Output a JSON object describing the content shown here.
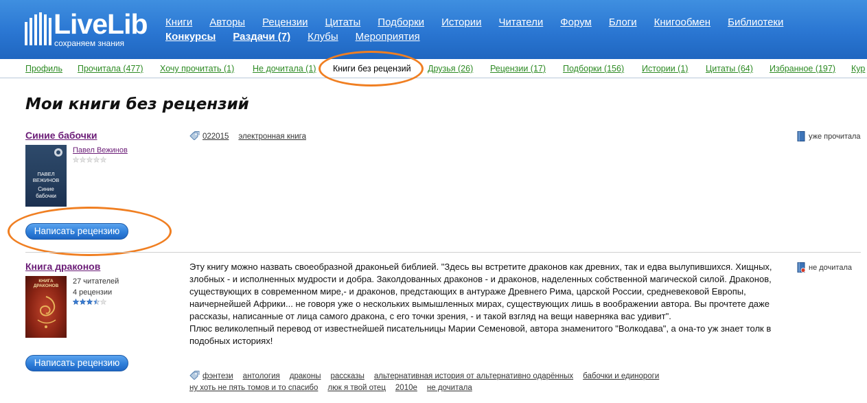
{
  "header": {
    "logo_word": "LiveLib",
    "logo_tagline": "сохраняем знания",
    "nav_row1": [
      "Книги",
      "Авторы",
      "Рецензии",
      "Цитаты",
      "Подборки",
      "Истории",
      "Читатели",
      "Форум",
      "Блоги",
      "Книгообмен",
      "Библиотеки"
    ],
    "nav_row2": [
      "Конкурсы",
      "Раздачи (7)",
      "Клубы",
      "Мероприятия"
    ]
  },
  "subnav": {
    "items": [
      "Профиль",
      "Прочитала (477)",
      "Хочу прочитать (1)",
      "Не дочитала (1)",
      "Книги без рецензий",
      "Друзья (26)",
      "Рецензии (17)",
      "Подборки (156)",
      "Истории (1)",
      "Цитаты (64)",
      "Избранное (197)",
      "Кур"
    ],
    "active_index": 4
  },
  "page": {
    "title": "Мои книги без рецензий"
  },
  "books": [
    {
      "title": "Синие бабочки",
      "author": "Павел Вежинов",
      "cover_author": "ПАВЕЛ ВЕЖИНОВ",
      "cover_title": "Синие бабочки",
      "rating_stars": 0,
      "review_button": "Написать рецензию",
      "tags": [
        "022015",
        "электронная книга"
      ],
      "status": "уже прочитала"
    },
    {
      "title": "Книга драконов",
      "readers": "27 читателей",
      "reviews": "4 рецензии",
      "rating_stars": 3.5,
      "cover_title": "КНИГА ДРАКОНОВ",
      "description_p1": "Эту книгу можно назвать своеобразной драконьей библией. \"Здесь вы встретите драконов как древних, так и едва вылупившихся. Хищных, злобных - и исполненных мудрости и добра. Заколдованных драконов - и драконов, наделенных собственной магической силой. Драконов, существующих в современном мире,- и драконов, предстающих в антураже Древнего Рима, царской России, средневековой Европы, наичернейшей Африки... не говоря уже о нескольких вымышленных мирах, существующих лишь в воображении автора. Вы прочтете даже рассказы, написанные от лица самого дракона, с его точки зрения, - и такой взгляд на вещи наверняка вас удивит\".",
      "description_p2": "Плюс великолепный перевод от известнейшей писательницы Марии Семеновой, автора знаменитого \"Волкодава\", а она-то уж знает толк в подобных историях!",
      "review_button": "Написать рецензию",
      "tags_row1": [
        "фэнтези",
        "антология",
        "драконы",
        "рассказы",
        "альтернативная история от альтернативно одарённых",
        "бабочки и единороги"
      ],
      "tags_row2": [
        "ну хоть не пять томов и то спасибо",
        "люк я твой отец",
        "2010е",
        "не дочитала"
      ],
      "status": "не дочитала"
    }
  ],
  "colors": {
    "header_blue": "#2a76d2",
    "subnav_link": "#2c8a22",
    "book_title": "#6a1b76",
    "highlight_oval": "#f07f22",
    "button_blue": "#2f7fda"
  }
}
